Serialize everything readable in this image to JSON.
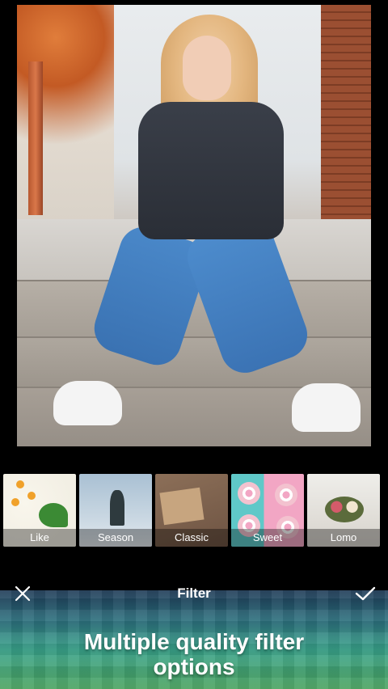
{
  "toolbar": {
    "title": "Filter",
    "close_icon": "close-icon",
    "confirm_icon": "checkmark-icon"
  },
  "filters": [
    {
      "label": "Like"
    },
    {
      "label": "Season"
    },
    {
      "label": "Classic"
    },
    {
      "label": "Sweet"
    },
    {
      "label": "Lomo"
    }
  ],
  "promo": {
    "line1": "Multiple quality filter",
    "line2": "options"
  },
  "colors": {
    "background": "#000000",
    "text": "#ffffff",
    "banner_top": "#1f3b57",
    "banner_bottom": "#4aa35f"
  }
}
